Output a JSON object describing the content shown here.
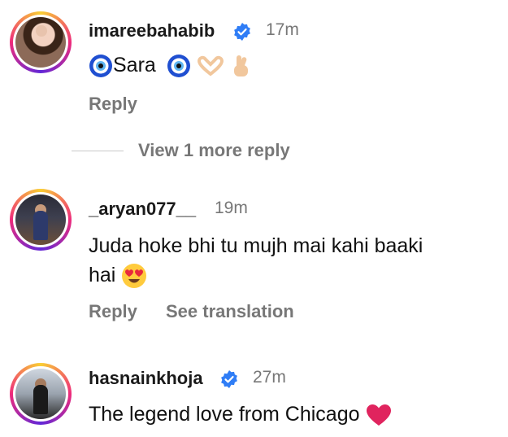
{
  "comments": [
    {
      "username": "imareebahabib",
      "verified": true,
      "time": "17m",
      "text_prefix": "",
      "text_name": "Sara",
      "reply": "Reply"
    },
    {
      "username": "_aryan077__",
      "verified": false,
      "time": "19m",
      "text_line1": "Juda hoke bhi tu mujh mai kahi baaki",
      "text_line2": "hai",
      "reply": "Reply",
      "translate": "See translation"
    },
    {
      "username": "hasnainkhoja",
      "verified": true,
      "time": "27m",
      "text": "The legend love from Chicago"
    }
  ],
  "view_more": "View 1 more reply",
  "colors": {
    "verified": "#2f7df6",
    "muted": "#777777",
    "heart": "#e0245e"
  }
}
